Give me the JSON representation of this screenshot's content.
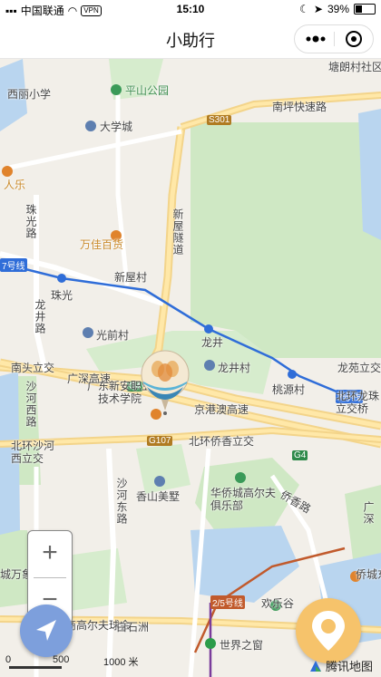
{
  "status_bar": {
    "carrier": "中国联通",
    "vpn": "VPN",
    "time": "15:10",
    "battery": "39%"
  },
  "nav": {
    "title": "小助行"
  },
  "map_labels": {
    "tanglang": "塘朗村社区",
    "xili_school": "西丽小学",
    "pingshan_park": "平山公园",
    "daxuecheng": "大学城",
    "s301": "S301",
    "nanping": "南坪快速路",
    "renle": "人乐",
    "zhuguanglu": "珠光路",
    "wanjia": "万佳百货",
    "xinwucun": "新屋村",
    "line7_left": "7号线",
    "zhuguang": "珠光",
    "longjing_rd": "龙井路",
    "xinwu_tunnel": "新屋隧道",
    "guangqian": "光前村",
    "longjing": "龙井",
    "longjingcun": "龙井村",
    "taoyuancun": "桃源村",
    "longyuan": "龙苑立交",
    "line7_right": "7号线",
    "nantou": "南头立交",
    "guangshen": "广深高速",
    "g4_left": "G4",
    "shahexilu": "沙河西路",
    "xinan_school": "广东新安职业技术学院",
    "jinggang": "京港澳高速",
    "g107": "G107",
    "beihuanqiaoxiang": "北环侨香立交",
    "beihuanlonghua": "北环龙珠立交桥",
    "beihuanshahexi": "北环沙河西立交",
    "g4_right": "G4",
    "shahedong": "沙河东路",
    "xiangshan": "香山美墅",
    "huaqiao_golf": "华侨城高尔夫俱乐部",
    "qiaoxiang": "侨香路",
    "guangshen2": "广深",
    "wanxiang": "城万象天地",
    "line2_5": "2/5号线",
    "mingye": "名商高尔夫球会",
    "huanlegu": "欢乐谷",
    "qiaocheng": "侨城东",
    "baishizhou": "白石洲",
    "shijie": "世界之窗"
  },
  "scale": {
    "zero": "0",
    "mid": "500",
    "max": "1000 米"
  },
  "attribution": "腾讯地图",
  "icons": {
    "zoom_in": "plus-icon",
    "zoom_out": "minus-icon",
    "locate": "navigation-arrow-icon",
    "pin": "location-pin-icon"
  },
  "colors": {
    "route_blue": "#2f6dd8",
    "pin_orange": "#f6c36b",
    "locate_blue": "#7d9fdc",
    "park_green": "#cfe8c4"
  }
}
